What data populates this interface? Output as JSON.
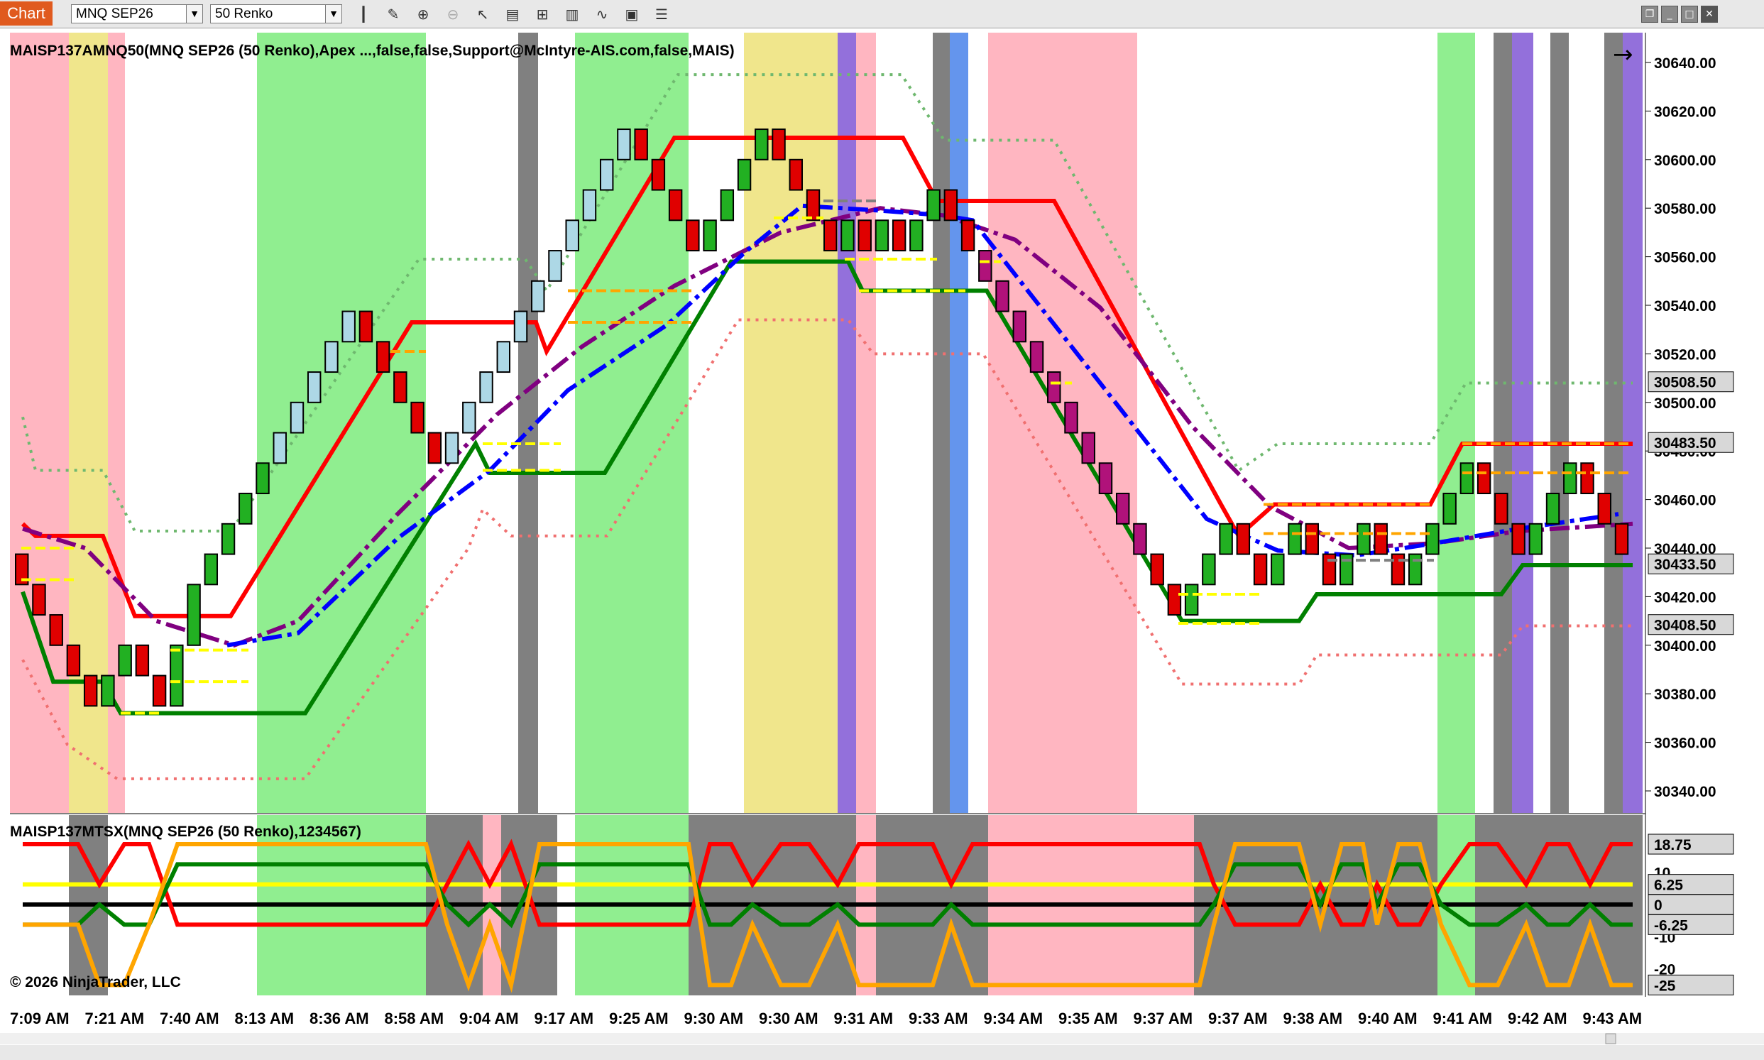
{
  "toolbar": {
    "tab_label": "Chart",
    "instrument": "MNQ SEP26",
    "bar_type": "50 Renko",
    "tools": [
      "bar-style-icon",
      "pencil-icon",
      "zoom-in-icon",
      "zoom-out-icon",
      "pointer-icon",
      "data-box-icon",
      "properties-icon",
      "strategies-icon",
      "indicators-icon",
      "templates-icon",
      "list-icon"
    ],
    "window_buttons": [
      "restore-icon",
      "minimize-icon",
      "maximize-icon",
      "close-icon"
    ]
  },
  "main_panel": {
    "indicator_label": "MAISP137AMNQ50(MNQ SEP26 (50 Renko),Apex ...,false,false,Support@McIntyre-AIS.com,false,MAIS)",
    "y_ticks": [
      "30640.00",
      "30620.00",
      "30600.00",
      "30580.00",
      "30560.00",
      "30540.00",
      "30520.00",
      "30500.00",
      "30480.00",
      "30460.00",
      "30440.00",
      "30420.00",
      "30400.00",
      "30380.00",
      "30360.00",
      "30340.00"
    ],
    "price_markers": [
      {
        "value": "30508.50",
        "color": "#d8d8d8"
      },
      {
        "value": "30483.50",
        "color": "#d8d8d8"
      },
      {
        "value": "30433.50",
        "color": "#d8d8d8"
      },
      {
        "value": "30408.50",
        "color": "#d8d8d8"
      }
    ],
    "nav_arrow": "→"
  },
  "sub_panel": {
    "indicator_label": "MAISP137MTSX(MNQ SEP26 (50 Renko),1234567)",
    "y_ticks": [
      "10",
      "0",
      "-10",
      "-20"
    ],
    "markers": [
      "18.75",
      "6.25",
      "0",
      "-6.25",
      "-25"
    ],
    "copyright": "© 2026 NinjaTrader, LLC"
  },
  "time_axis": [
    "7:09 AM",
    "7:21 AM",
    "7:40 AM",
    "8:13 AM",
    "8:36 AM",
    "8:58 AM",
    "9:04 AM",
    "9:17 AM",
    "9:25 AM",
    "9:30 AM",
    "9:30 AM",
    "9:31 AM",
    "9:33 AM",
    "9:34 AM",
    "9:35 AM",
    "9:37 AM",
    "9:37 AM",
    "9:38 AM",
    "9:40 AM",
    "9:41 AM",
    "9:42 AM",
    "9:43 AM"
  ],
  "colors": {
    "pink": "#ffb6c1",
    "khaki": "#f0e68c",
    "lightgreen": "#90ee90",
    "gray": "#808080",
    "purple": "#9370db",
    "blue": "#6495ed",
    "upper_band": "#ff0000",
    "lower_band": "#008000",
    "ma_purple": "#800080",
    "ma_blue": "#0000ff"
  },
  "chart_data": {
    "type": "renko",
    "brick_size_points": 12.5,
    "series": [
      {
        "name": "bricks",
        "close": [
          30425,
          30412.5,
          30400,
          30387.5,
          30375,
          30387.5,
          30400,
          30387.5,
          30375,
          30400,
          30425,
          30437.5,
          30450,
          30462.5,
          30475,
          30487.5,
          30500,
          30512.5,
          30525,
          30537.5,
          30525,
          30512.5,
          30500,
          30487.5,
          30475,
          30487.5,
          30500,
          30512.5,
          30525,
          30537.5,
          30550,
          30562.5,
          30575,
          30587.5,
          30600,
          30612.5,
          30600,
          30587.5,
          30575,
          30562.5,
          30575,
          30587.5,
          30600,
          30612.5,
          30600,
          30587.5,
          30575,
          30562.5,
          30575,
          30562.5,
          30575,
          30562.5,
          30575,
          30587.5,
          30575,
          30562.5,
          30550,
          30537.5,
          30525,
          30512.5,
          30500,
          30487.5,
          30475,
          30462.5,
          30450,
          30437.5,
          30425,
          30412.5,
          30425,
          30437.5,
          30450,
          30437.5,
          30425,
          30437.5,
          30450,
          30437.5,
          30425,
          30437.5,
          30450,
          30437.5,
          30425,
          30437.5,
          30450,
          30462.5,
          30475,
          30462.5,
          30450,
          30437.5,
          30450,
          30462.5,
          30475,
          30462.5,
          30450,
          30437.5
        ]
      }
    ],
    "ylim": [
      30325,
      30650
    ],
    "sub_ylim": [
      -28,
      23
    ]
  }
}
